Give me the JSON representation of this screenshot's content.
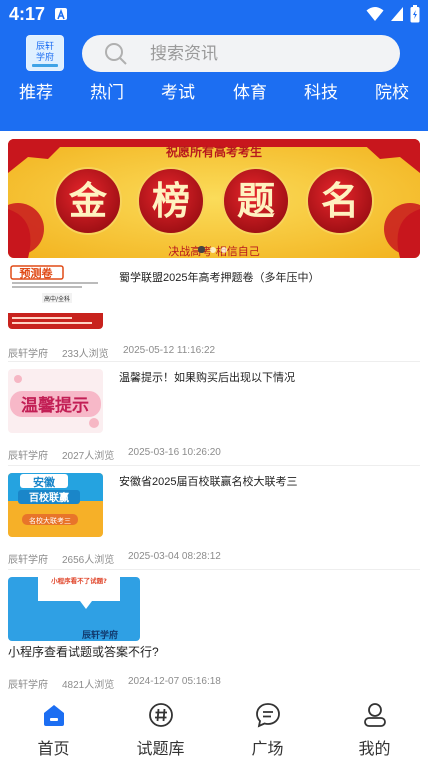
{
  "status_bar": {
    "time": "4:17"
  },
  "header": {
    "logo_text_line1": "辰轩",
    "logo_text_line2": "学府",
    "search": {
      "placeholder": "搜索资讯"
    },
    "tabs": [
      "推荐",
      "热门",
      "考试",
      "体育",
      "科技",
      "院校"
    ]
  },
  "banner": {
    "top_text": "祝愿所有高考考生",
    "characters": [
      "金",
      "榜",
      "题",
      "名"
    ],
    "bottom_text": "决战高考  相信自己",
    "slide_count": 3,
    "active_slide": 0
  },
  "feed": [
    {
      "title": "蜀学联盟2025年高考押题卷（多年压中）",
      "source": "辰轩学府",
      "views": "233人浏览",
      "date": "2025-05-12 11:16:22",
      "thumb_text": "预测卷",
      "thumb_sub": "高中/全科"
    },
    {
      "title": "温馨提示！如果购买后出现以下情况",
      "source": "辰轩学府",
      "views": "2027人浏览",
      "date": "2025-03-16 10:26:20",
      "thumb_text": "温馨提示"
    },
    {
      "title": "安徽省2025届百校联赢名校大联考三",
      "source": "辰轩学府",
      "views": "2656人浏览",
      "date": "2025-03-04 08:28:12",
      "thumb_text": "安徽",
      "thumb_sub": "百校联赢",
      "thumb_sub2": "名校大联考三"
    },
    {
      "title": "小程序查看试题或答案不行?",
      "source": "辰轩学府",
      "views": "4821人浏览",
      "date": "2024-12-07 05:16:18",
      "thumb_text": "小程序看不了试题?",
      "thumb_sub": "辰轩学府"
    }
  ],
  "tabbar": [
    {
      "label": "首页",
      "icon": "home-icon",
      "active": true
    },
    {
      "label": "试题库",
      "icon": "hash-icon",
      "active": false
    },
    {
      "label": "广场",
      "icon": "chat-icon",
      "active": false
    },
    {
      "label": "我的",
      "icon": "user-icon",
      "active": false
    }
  ],
  "colors": {
    "primary": "#1c6ef2",
    "banner_red": "#c8161d",
    "banner_gold": "#f6c231"
  }
}
